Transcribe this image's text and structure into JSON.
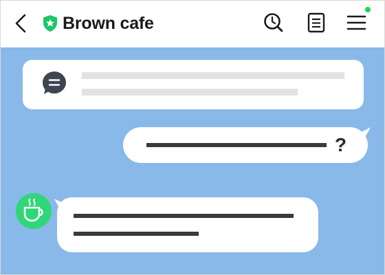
{
  "header": {
    "title": "Brown cafe",
    "icons": [
      "back-arrow-icon",
      "verified-shield-icon",
      "search-icon",
      "notes-icon",
      "menu-icon"
    ],
    "online": true
  },
  "chat": {
    "notice": {
      "icon": "speech-bubble-icon"
    },
    "outgoing": {
      "suffix": "?"
    },
    "incoming": {
      "avatar_icon": "coffee-cup-icon"
    }
  },
  "colors": {
    "chat_background": "#89b9e8",
    "header_background": "#ffffff",
    "badge_green": "#1fc46a",
    "avatar_green": "#2fd778",
    "online_dot": "#1fd35b",
    "bubble": "#ffffff",
    "text_dark": "#1a1a1a"
  }
}
